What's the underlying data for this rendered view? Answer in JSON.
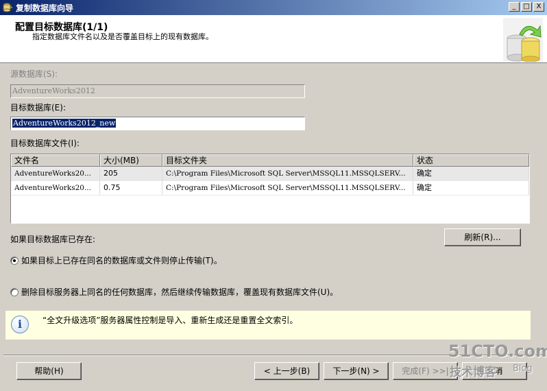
{
  "window": {
    "title": "复制数据库向导",
    "minimize": "_",
    "maximize": "□",
    "close": "X"
  },
  "header": {
    "title": "配置目标数据库(1/1)",
    "subtitle": "指定数据库文件名以及是否覆盖目标上的现有数据库。"
  },
  "source_db": {
    "label": "源数据库(S):",
    "value": "AdventureWorks2012"
  },
  "target_db": {
    "label": "目标数据库(E):",
    "value": "AdventureWorks2012_new"
  },
  "files": {
    "label": "目标数据库文件(I):",
    "columns": [
      "文件名",
      "大小(MB)",
      "目标文件夹",
      "状态"
    ],
    "rows": [
      [
        "AdventureWorks20...",
        "205",
        "C:\\Program Files\\Microsoft SQL Server\\MSSQL11.MSSQLSERV...",
        "确定"
      ],
      [
        "AdventureWorks20...",
        "0.75",
        "C:\\Program Files\\Microsoft SQL Server\\MSSQL11.MSSQLSERV...",
        "确定"
      ]
    ]
  },
  "if_exists": {
    "label": "如果目标数据库已存在:",
    "refresh": "刷新(R)...",
    "option_stop": "如果目标上已存在同名的数据库或文件则停止传输(T)。",
    "option_drop": "删除目标服务器上同名的任何数据库，然后继续传输数据库，覆盖现有数据库文件(U)。",
    "selected": "stop"
  },
  "info": {
    "text": "“全文升级选项”服务器属性控制是导入、重新生成还是重置全文索引。"
  },
  "buttons": {
    "help": "帮助(H)",
    "back": "< 上一步(B)",
    "next": "下一步(N) >",
    "finish": "完成(F) >>|",
    "cancel": "取消"
  },
  "watermark": {
    "line1": "51CTO.com",
    "line2": "技术博客",
    "line3": "Blog"
  },
  "colors": {
    "title_bar_start": "#0a246a",
    "title_bar_end": "#a6caf0",
    "dialog_bg": "#d4d0c8",
    "info_bg": "#ffffe1"
  }
}
